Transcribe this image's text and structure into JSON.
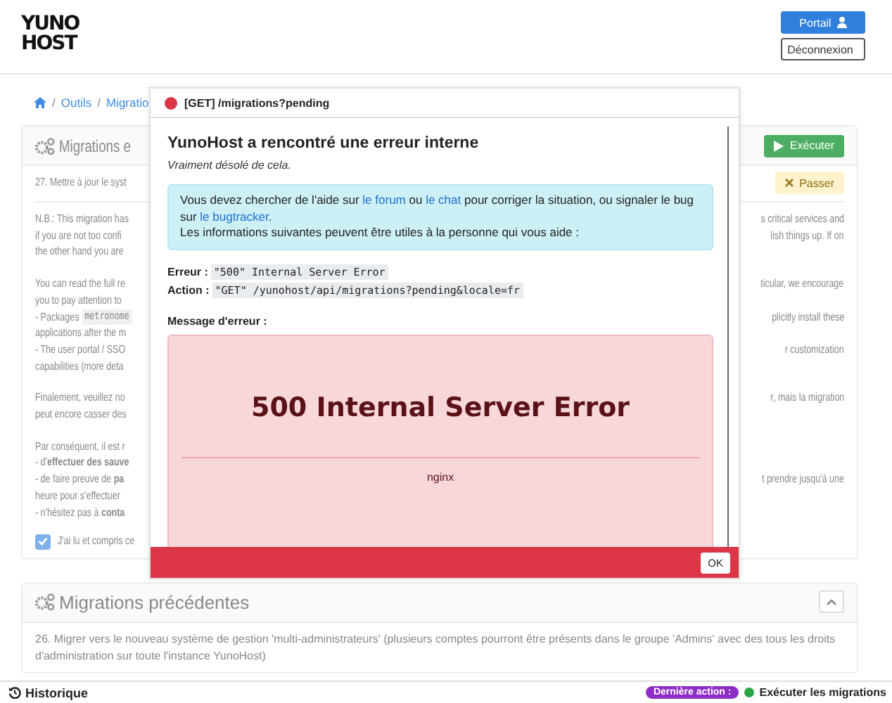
{
  "logo": {
    "line_1": "YUNO",
    "line_2": "HOST"
  },
  "header_buttons": [
    {
      "label": "Portail",
      "kind": "primary"
    },
    {
      "label": "Déconnexion",
      "kind": "outline"
    }
  ],
  "breadcrumb": {
    "separator": "/",
    "items": [
      "Outils",
      "Migratio"
    ]
  },
  "pending_card": {
    "title": "Migrations e",
    "run_button": {
      "label": "Exécuter",
      "disabled": true
    },
    "migration_title": "27. Mettre à jour le syst",
    "skip_button": "Passer",
    "paragraphs": [
      [
        {
          "left": "N.B.: This migration has",
          "right": "s critical services and"
        },
        {
          "left": "if you are not too confi",
          "right": "lish things up. If on"
        },
        {
          "left": "the other hand you are"
        }
      ],
      [
        {
          "left": "You can read the full re",
          "right": "ticular, we encourage"
        },
        {
          "left": "you to pay attention to"
        },
        {
          "left": "- Packages",
          "code": "metronome",
          "right": "plicitly install these"
        },
        {
          "left": "applications after the m"
        },
        {
          "left": "- The user portal / SSO",
          "right": "r customization"
        },
        {
          "left": "capabilities (more deta"
        }
      ],
      [
        {
          "left": "Finalement, veuillez no",
          "right": "r, mais la migration"
        },
        {
          "left": "peut encore casser des"
        }
      ],
      [
        {
          "left": "Par conséquent, il est r"
        },
        {
          "left": "- d'**effectuer des sauve**"
        },
        {
          "left": "- de faire preuve de **pa**",
          "right": "t prendre jusqu'à une"
        },
        {
          "left": "heure pour s'effectuer"
        },
        {
          "left": "- n'hésitez pas à **conta**"
        }
      ]
    ],
    "confirm": {
      "label": "J'ai lu et compris ce",
      "checked": true
    }
  },
  "previous_card": {
    "title": "Migrations précédentes",
    "expanded": true,
    "description": "26. Migrer vers le nouveau système de gestion 'multi-administrateurs' (plusieurs comptes pourront être présents dans le groupe 'Admins' avec des tous les droits d'administration sur toute l'instance YunoHost)"
  },
  "modal": {
    "title": "[GET] /migrations?pending",
    "heading": "YunoHost a rencontré une erreur interne",
    "subheading": "Vraiment désolé de cela.",
    "help_parts": [
      {
        "text": "Vous devez chercher de l'aide sur ",
        "kind": "text"
      },
      {
        "text": "le forum",
        "kind": "link"
      },
      {
        "text": " ou ",
        "kind": "text"
      },
      {
        "text": "le chat",
        "kind": "link"
      },
      {
        "text": " pour corriger la situation, ou signaler le bug sur ",
        "kind": "text"
      },
      {
        "text": "le bugtracker",
        "kind": "link"
      },
      {
        "text": ".",
        "kind": "text"
      }
    ],
    "help_note": "Les informations suivantes peuvent être utiles à la personne qui vous aide :",
    "details": [
      {
        "label": "Erreur :",
        "value": "\"500\" Internal Server Error"
      },
      {
        "label": "Action :",
        "value": "\"GET\" /yunohost/api/migrations?pending&locale=fr"
      }
    ],
    "message_label": "Message d'erreur :",
    "error_title": "500 Internal Server Error",
    "error_server": "nginx",
    "ok_button": "OK"
  },
  "bottom_bar": {
    "history": "Historique",
    "last_action_badge": "Dernière action :",
    "last_action": "Exécuter les migrations"
  }
}
